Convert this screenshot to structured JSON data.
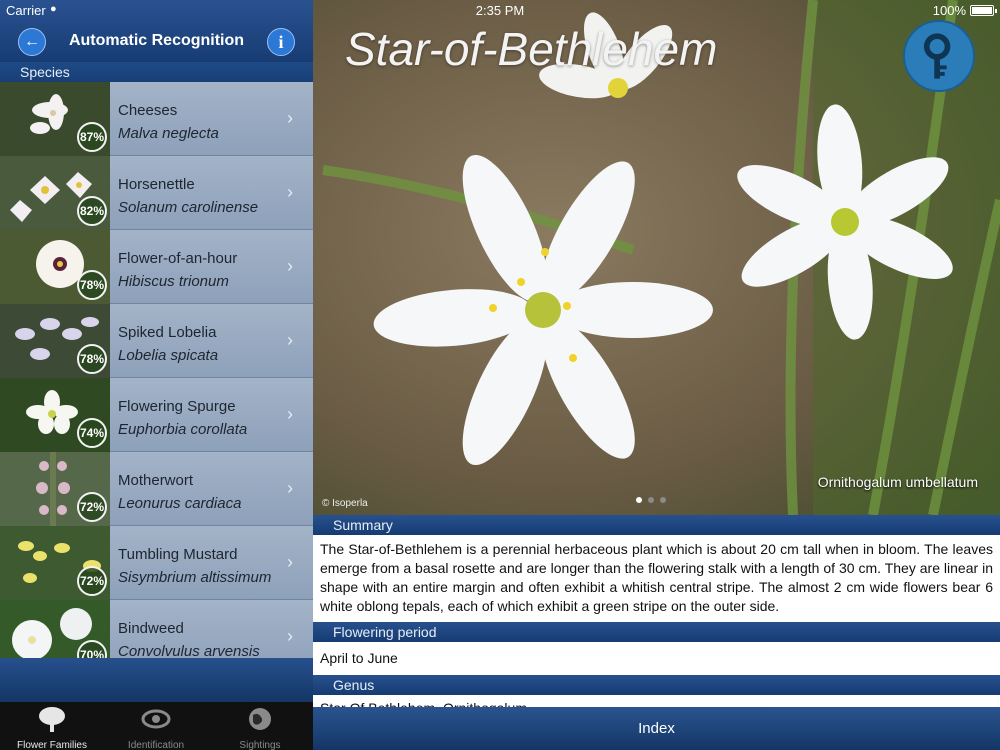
{
  "status": {
    "carrier": "Carrier",
    "time": "2:35 PM",
    "battery": "100%"
  },
  "nav": {
    "title": "Automatic Recognition"
  },
  "sections": {
    "species": "Species"
  },
  "species": [
    {
      "common": "Cheeses",
      "latin": "Malva neglecta",
      "match": "87%"
    },
    {
      "common": "Horsenettle",
      "latin": "Solanum carolinense",
      "match": "82%"
    },
    {
      "common": "Flower-of-an-hour",
      "latin": "Hibiscus trionum",
      "match": "78%"
    },
    {
      "common": "Spiked Lobelia",
      "latin": "Lobelia spicata",
      "match": "78%"
    },
    {
      "common": "Flowering Spurge",
      "latin": "Euphorbia corollata",
      "match": "74%"
    },
    {
      "common": "Motherwort",
      "latin": "Leonurus cardiaca",
      "match": "72%"
    },
    {
      "common": "Tumbling Mustard",
      "latin": "Sisymbrium altissimum",
      "match": "72%"
    },
    {
      "common": "Bindweed",
      "latin": "Convolvulus arvensis",
      "match": "70%"
    }
  ],
  "tabs": [
    {
      "label": "Flower Families",
      "icon": "tree-icon"
    },
    {
      "label": "Identification",
      "icon": "eye-icon"
    },
    {
      "label": "Sightings",
      "icon": "globe-icon"
    }
  ],
  "plant": {
    "title": "Star-of-Bethlehem",
    "latin": "Ornithogalum umbellatum",
    "credit": "© Isoperla"
  },
  "details": {
    "summary_title": "Summary",
    "summary": "The Star-of-Bethlehem is a perennial herbaceous plant which is about 20 cm tall when in bloom. The leaves emerge from a basal rosette and are longer than the flowering stalk with a length of 30 cm. They are linear in shape with an entire margin and often exhibit a whitish central stripe. The almost 2 cm wide flowers bear 6 white oblong tepals, each of which exhibit a green stripe on the outer side.",
    "flowering_title": "Flowering period",
    "flowering": "April to June",
    "genus_title": "Genus",
    "genus": "Star Of Bethlehem, Ornithogalum"
  },
  "bottom": {
    "index_label": "Index"
  },
  "colors": {
    "nav_blue": "#1f4a86",
    "row_bg": "#9aabc2",
    "key_button": "#2a7db8"
  }
}
